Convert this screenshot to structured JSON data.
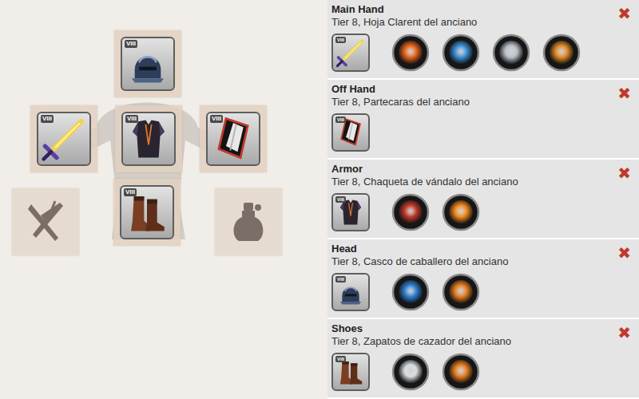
{
  "doll": {
    "slots": [
      {
        "kind": "helmet",
        "badge": "VIII",
        "empty": false
      },
      {
        "kind": "sword",
        "badge": "VIII",
        "empty": false
      },
      {
        "kind": "armor",
        "badge": "VIII",
        "empty": false
      },
      {
        "kind": "shield",
        "badge": "VIII",
        "empty": false
      },
      {
        "kind": "food",
        "badge": "",
        "empty": true
      },
      {
        "kind": "boots",
        "badge": "VIII",
        "empty": false
      },
      {
        "kind": "potion",
        "badge": "",
        "empty": true
      }
    ]
  },
  "sections": [
    {
      "label": "Main Hand",
      "name": "Tier 8, Hoja Clarent del anciano",
      "kind": "sword",
      "badge": "VIII",
      "remove": "✖",
      "spells": [
        {
          "color": "#e8641c"
        },
        {
          "color": "#3a8fd6"
        },
        {
          "color": "#b8c0c8"
        },
        {
          "color": "#e08a2a"
        }
      ]
    },
    {
      "label": "Off Hand",
      "name": "Tier 8, Partecaras del anciano",
      "kind": "shield",
      "badge": "VIII",
      "remove": "✖",
      "spells": []
    },
    {
      "label": "Armor",
      "name": "Tier 8, Chaqueta de vándalo del anciano",
      "kind": "armor",
      "badge": "VIII",
      "remove": "✖",
      "spells": [
        {
          "color": "#c0392b"
        },
        {
          "color": "#f08a1c"
        }
      ]
    },
    {
      "label": "Head",
      "name": "Tier 8, Casco de caballero del anciano",
      "kind": "helmet",
      "badge": "VIII",
      "remove": "✖",
      "spells": [
        {
          "color": "#2f7fd0"
        },
        {
          "color": "#e67e22"
        }
      ]
    },
    {
      "label": "Shoes",
      "name": "Tier 8, Zapatos de cazador del anciano",
      "kind": "boots",
      "badge": "VIII",
      "remove": "✖",
      "spells": [
        {
          "color": "#d8dde2"
        },
        {
          "color": "#e67e22"
        }
      ]
    }
  ]
}
